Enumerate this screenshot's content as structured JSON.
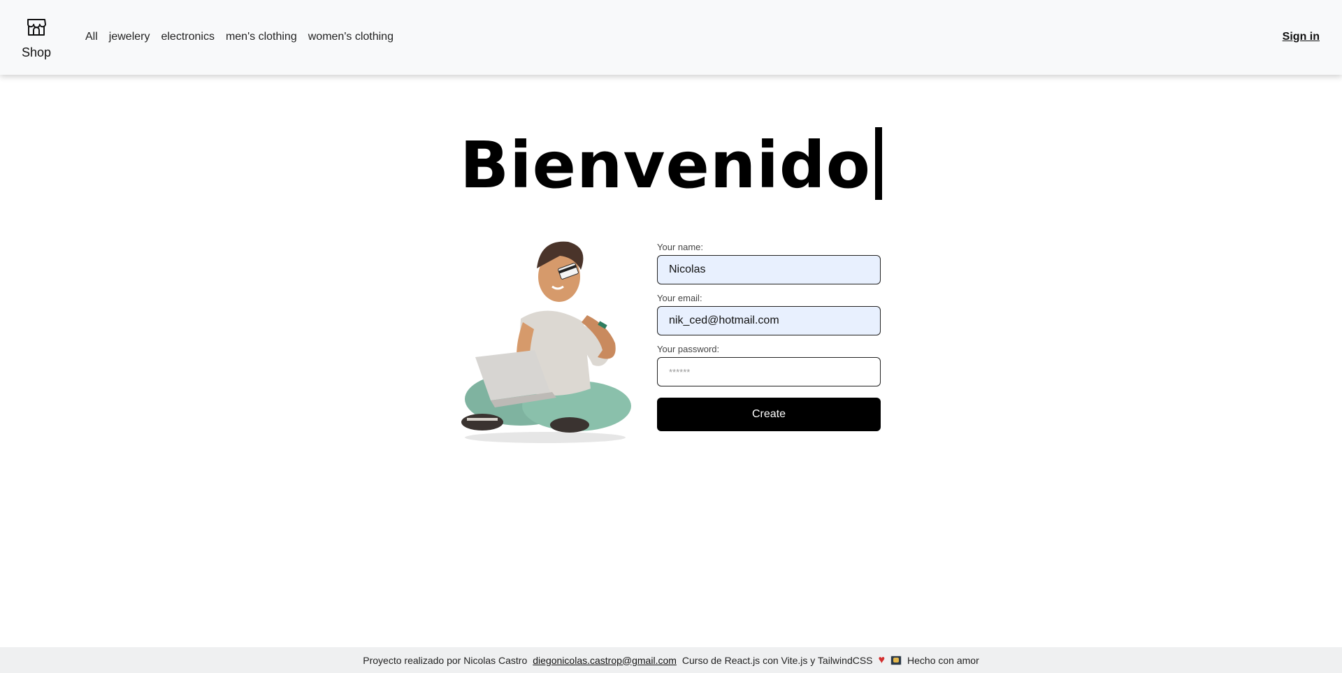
{
  "navbar": {
    "brand_label": "Shop",
    "links": [
      "All",
      "jewelery",
      "electronics",
      "men's clothing",
      "women's clothing"
    ],
    "signin_label": "Sign in"
  },
  "main": {
    "headline": "Bienvenido",
    "form": {
      "name_label": "Your name:",
      "name_value": "Nicolas",
      "email_label": "Your email:",
      "email_value": "nik_ced@hotmail.com",
      "password_label": "Your password:",
      "password_value": "******",
      "submit_label": "Create"
    }
  },
  "footer": {
    "credit_text": "Proyecto realizado por Nicolas Castro",
    "email_link": "diegonicolas.castrop@gmail.com",
    "course_text": "Curso de React.js con Vite.js y TailwindCSS",
    "heart_icon": "♥",
    "made_with": "Hecho con amor"
  },
  "colors": {
    "navbar_bg": "#f8f9fa",
    "autofill_bg": "#e8f0fe",
    "button_bg": "#000000",
    "footer_bg": "#eff0f1",
    "heart": "#d32f2f"
  }
}
